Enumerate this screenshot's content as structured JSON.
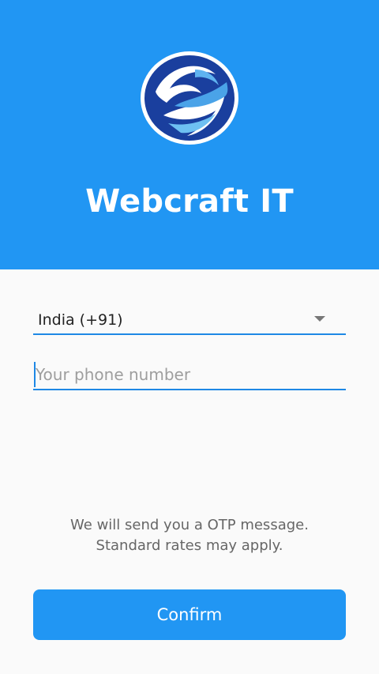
{
  "header": {
    "app_title": "Webcraft IT",
    "logo_icon": "webcraft-swirl-logo-icon",
    "background_color": "#2196f3"
  },
  "form": {
    "country_selected": "India (+91)",
    "country_dropdown_icon": "chevron-down-icon",
    "phone_placeholder": "Your phone number",
    "phone_value": ""
  },
  "info": {
    "line1": "We will send you a OTP message.",
    "line2": "Standard rates may apply."
  },
  "actions": {
    "confirm_label": "Confirm",
    "confirm_color": "#2196f3"
  }
}
